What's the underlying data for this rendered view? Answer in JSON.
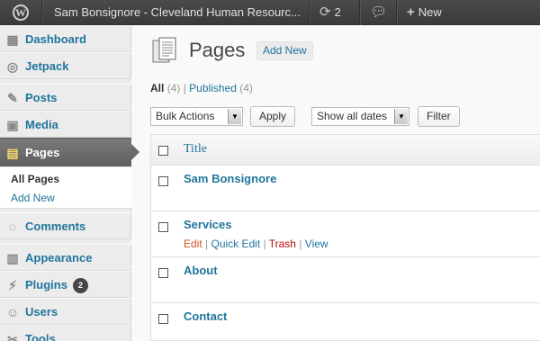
{
  "adminbar": {
    "site_name": "Sam Bonsignore - Cleveland Human Resourc...",
    "updates_count": "2",
    "new_label": "New"
  },
  "sidebar": {
    "items": [
      {
        "label": "Dashboard",
        "icon": "dashboard-icon"
      },
      {
        "label": "Jetpack",
        "icon": "jetpack-icon"
      },
      {
        "label": "Posts",
        "icon": "pin-icon"
      },
      {
        "label": "Media",
        "icon": "media-icon"
      },
      {
        "label": "Pages",
        "icon": "pages-icon"
      },
      {
        "label": "Comments",
        "icon": "comments-icon"
      },
      {
        "label": "Appearance",
        "icon": "appearance-icon"
      },
      {
        "label": "Plugins",
        "icon": "plugins-icon",
        "badge": "2"
      },
      {
        "label": "Users",
        "icon": "users-icon"
      },
      {
        "label": "Tools",
        "icon": "tools-icon"
      }
    ],
    "submenu": {
      "all_pages": "All Pages",
      "add_new": "Add New"
    }
  },
  "main": {
    "title": "Pages",
    "add_new": "Add New",
    "filters": {
      "all": "All",
      "all_count": "(4)",
      "sep": "|",
      "published": "Published",
      "published_count": "(4)"
    },
    "bulk_actions": "Bulk Actions",
    "apply": "Apply",
    "dates": "Show all dates",
    "filter": "Filter",
    "table": {
      "column_title": "Title",
      "rows": [
        {
          "title": "Sam Bonsignore"
        },
        {
          "title": "Services",
          "actions": {
            "edit": "Edit",
            "quick_edit": "Quick Edit",
            "trash": "Trash",
            "view": "View"
          }
        },
        {
          "title": "About"
        },
        {
          "title": "Contact"
        }
      ]
    }
  },
  "colors": {
    "link": "#21759b",
    "adminbar": "#464646",
    "current_menu": "#6a6a6a",
    "trash": "#bc0b0b",
    "edit": "#d54e21"
  }
}
